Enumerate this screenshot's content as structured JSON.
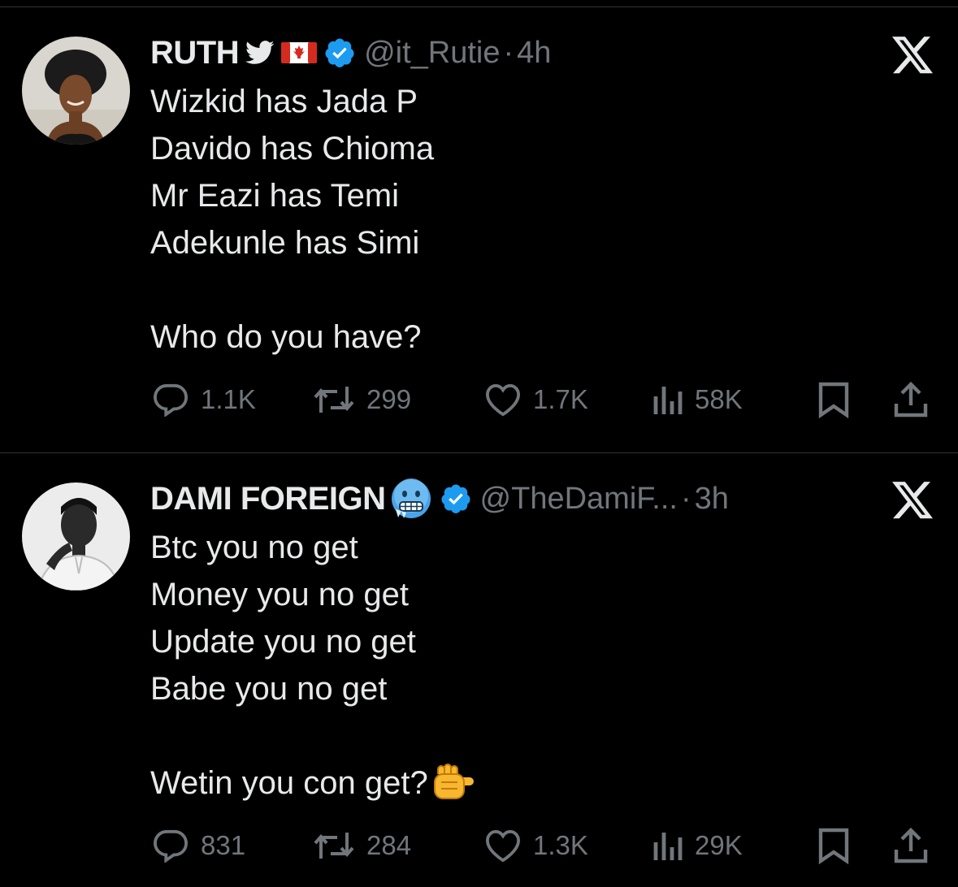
{
  "tweets": [
    {
      "display_name": "RUTH",
      "name_icons": [
        "twitter-bird-icon",
        "canada-flag-icon",
        "verified-badge-icon"
      ],
      "handle": "@it_Rutie",
      "separator": "·",
      "time": "4h",
      "lines": [
        "Wizkid has Jada P",
        "Davido has Chioma",
        "Mr Eazi has Temi",
        "Adekunle has Simi",
        "",
        "Who do you have?"
      ],
      "replies": "1.1K",
      "retweets": "299",
      "likes": "1.7K",
      "views": "58K"
    },
    {
      "display_name": "DAMI FOREIGN",
      "name_icons": [
        "freezing-face-emoji-icon",
        "verified-badge-icon"
      ],
      "handle": "@TheDamiF...",
      "separator": "·",
      "time": "3h",
      "lines": [
        "Btc you no get",
        "Money you no get",
        "Update you no get",
        "Babe you no get",
        "",
        "Wetin you con get?"
      ],
      "trailing_emoji": "pointing-fist-emoji-icon",
      "replies": "831",
      "retweets": "284",
      "likes": "1.3K",
      "views": "29K"
    }
  ],
  "colors": {
    "background": "#000000",
    "text": "#e7e9ea",
    "muted": "#71767b",
    "verified": "#1d9bf0",
    "divider": "#2f3336"
  }
}
